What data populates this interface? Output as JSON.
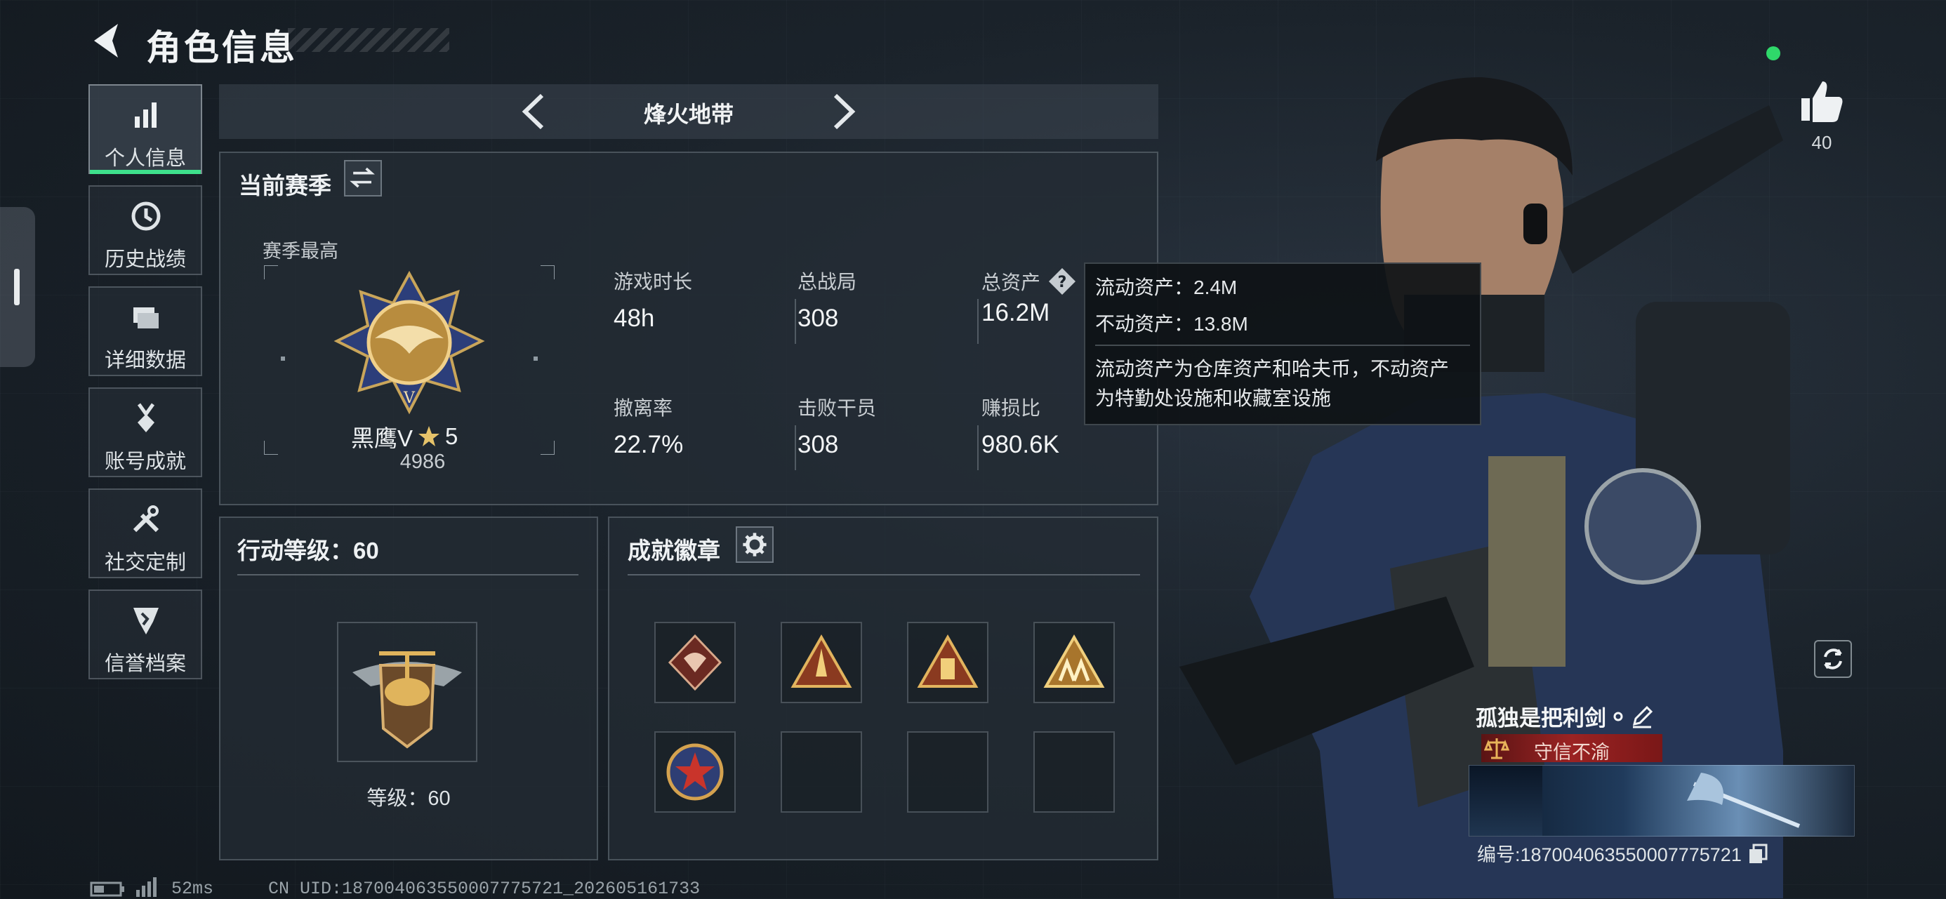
{
  "header": {
    "title": "角色信息"
  },
  "sidebar": {
    "items": [
      {
        "label": "个人信息",
        "icon": "bar-chart-icon",
        "active": true
      },
      {
        "label": "历史战绩",
        "icon": "history-clock-icon",
        "active": false
      },
      {
        "label": "详细数据",
        "icon": "folder-stack-icon",
        "active": false
      },
      {
        "label": "账号成就",
        "icon": "medal-ribbon-icon",
        "active": false
      },
      {
        "label": "社交定制",
        "icon": "tools-icon",
        "active": false
      },
      {
        "label": "信誉档案",
        "icon": "shield-badge-icon",
        "active": false
      }
    ]
  },
  "mode_tabs": {
    "current": "烽火地带"
  },
  "season": {
    "title": "当前赛季",
    "best_label": "赛季最高",
    "rank_name": "黑鹰V",
    "rank_stars": "5",
    "rank_points": "4986",
    "stats": [
      {
        "label": "游戏时长",
        "value": "48h"
      },
      {
        "label": "总战局",
        "value": "308"
      },
      {
        "label": "总资产",
        "value": "16.2M"
      },
      {
        "label": "撤离率",
        "value": "22.7%"
      },
      {
        "label": "击败干员",
        "value": "308"
      },
      {
        "label": "赚损比",
        "value": "980.6K"
      }
    ]
  },
  "asset_tooltip": {
    "liquid": "流动资产：2.4M",
    "fixed": "不动资产：13.8M",
    "desc_line1": "流动资产为仓库资产和哈夫币，不动资产",
    "desc_line2": "为特勤处设施和收藏室设施"
  },
  "action_level": {
    "title": "行动等级：60",
    "level_text": "等级：60"
  },
  "achievements": {
    "title": "成就徽章",
    "badges": [
      "dragon-badge",
      "rocket-triangle-badge",
      "tower-triangle-badge",
      "soldiers-triangle-badge",
      "star-emblem-badge",
      "empty",
      "empty",
      "empty"
    ]
  },
  "player": {
    "name": "孤独是把利剑",
    "honor_title": "守信不渝",
    "uid_label": "编号:18700406355000777572​1",
    "likes": "40"
  },
  "footer": {
    "ping": "52ms",
    "uid": "CN UID:18700406355000777572​1_202605161733"
  },
  "colors": {
    "accent": "#3ee08c",
    "honor": "#9b2323",
    "online": "#2fd86a"
  }
}
